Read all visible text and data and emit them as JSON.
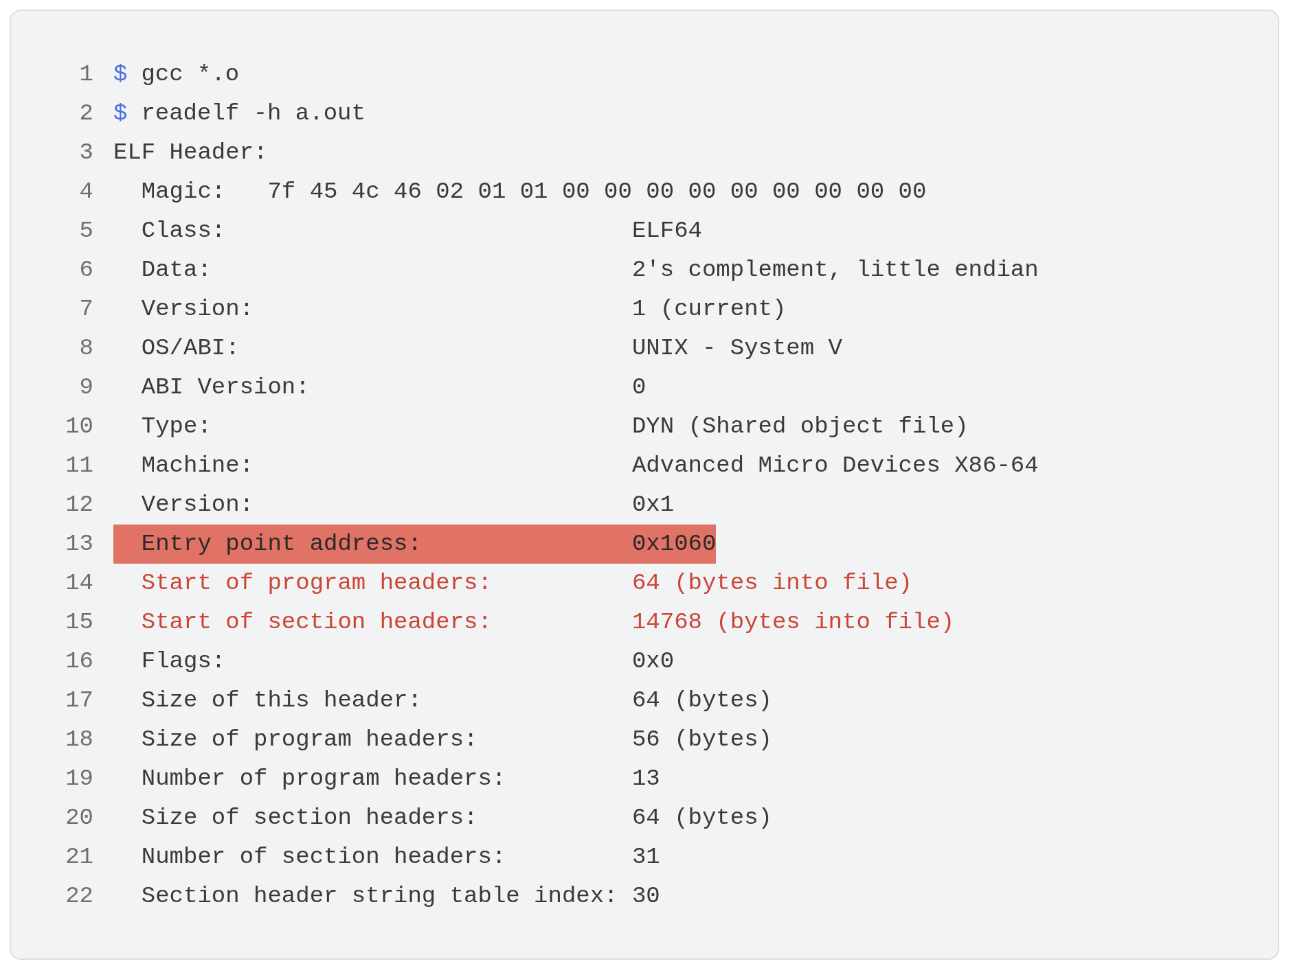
{
  "lines": [
    {
      "number": "1",
      "kind": "command",
      "prompt": "$",
      "text": "gcc *.o"
    },
    {
      "number": "2",
      "kind": "command",
      "prompt": "$",
      "text": "readelf -h a.out"
    },
    {
      "number": "3",
      "kind": "output",
      "highlighted": false,
      "emphasized": false,
      "text": "ELF Header:"
    },
    {
      "number": "4",
      "kind": "output",
      "highlighted": false,
      "emphasized": false,
      "text": "  Magic:   7f 45 4c 46 02 01 01 00 00 00 00 00 00 00 00 00"
    },
    {
      "number": "5",
      "kind": "output",
      "highlighted": false,
      "emphasized": false,
      "text": "  Class:                             ELF64"
    },
    {
      "number": "6",
      "kind": "output",
      "highlighted": false,
      "emphasized": false,
      "text": "  Data:                              2's complement, little endian"
    },
    {
      "number": "7",
      "kind": "output",
      "highlighted": false,
      "emphasized": false,
      "text": "  Version:                           1 (current)"
    },
    {
      "number": "8",
      "kind": "output",
      "highlighted": false,
      "emphasized": false,
      "text": "  OS/ABI:                            UNIX - System V"
    },
    {
      "number": "9",
      "kind": "output",
      "highlighted": false,
      "emphasized": false,
      "text": "  ABI Version:                       0"
    },
    {
      "number": "10",
      "kind": "output",
      "highlighted": false,
      "emphasized": false,
      "text": "  Type:                              DYN (Shared object file)"
    },
    {
      "number": "11",
      "kind": "output",
      "highlighted": false,
      "emphasized": false,
      "text": "  Machine:                           Advanced Micro Devices X86-64"
    },
    {
      "number": "12",
      "kind": "output",
      "highlighted": false,
      "emphasized": false,
      "text": "  Version:                           0x1"
    },
    {
      "number": "13",
      "kind": "output",
      "highlighted": true,
      "emphasized": false,
      "text": "  Entry point address:               0x1060"
    },
    {
      "number": "14",
      "kind": "output",
      "highlighted": false,
      "emphasized": true,
      "text": "  Start of program headers:          64 (bytes into file)"
    },
    {
      "number": "15",
      "kind": "output",
      "highlighted": false,
      "emphasized": true,
      "text": "  Start of section headers:          14768 (bytes into file)"
    },
    {
      "number": "16",
      "kind": "output",
      "highlighted": false,
      "emphasized": false,
      "text": "  Flags:                             0x0"
    },
    {
      "number": "17",
      "kind": "output",
      "highlighted": false,
      "emphasized": false,
      "text": "  Size of this header:               64 (bytes)"
    },
    {
      "number": "18",
      "kind": "output",
      "highlighted": false,
      "emphasized": false,
      "text": "  Size of program headers:           56 (bytes)"
    },
    {
      "number": "19",
      "kind": "output",
      "highlighted": false,
      "emphasized": false,
      "text": "  Number of program headers:         13"
    },
    {
      "number": "20",
      "kind": "output",
      "highlighted": false,
      "emphasized": false,
      "text": "  Size of section headers:           64 (bytes)"
    },
    {
      "number": "21",
      "kind": "output",
      "highlighted": false,
      "emphasized": false,
      "text": "  Number of section headers:         31"
    },
    {
      "number": "22",
      "kind": "output",
      "highlighted": false,
      "emphasized": false,
      "text": "  Section header string table index: 30"
    }
  ]
}
